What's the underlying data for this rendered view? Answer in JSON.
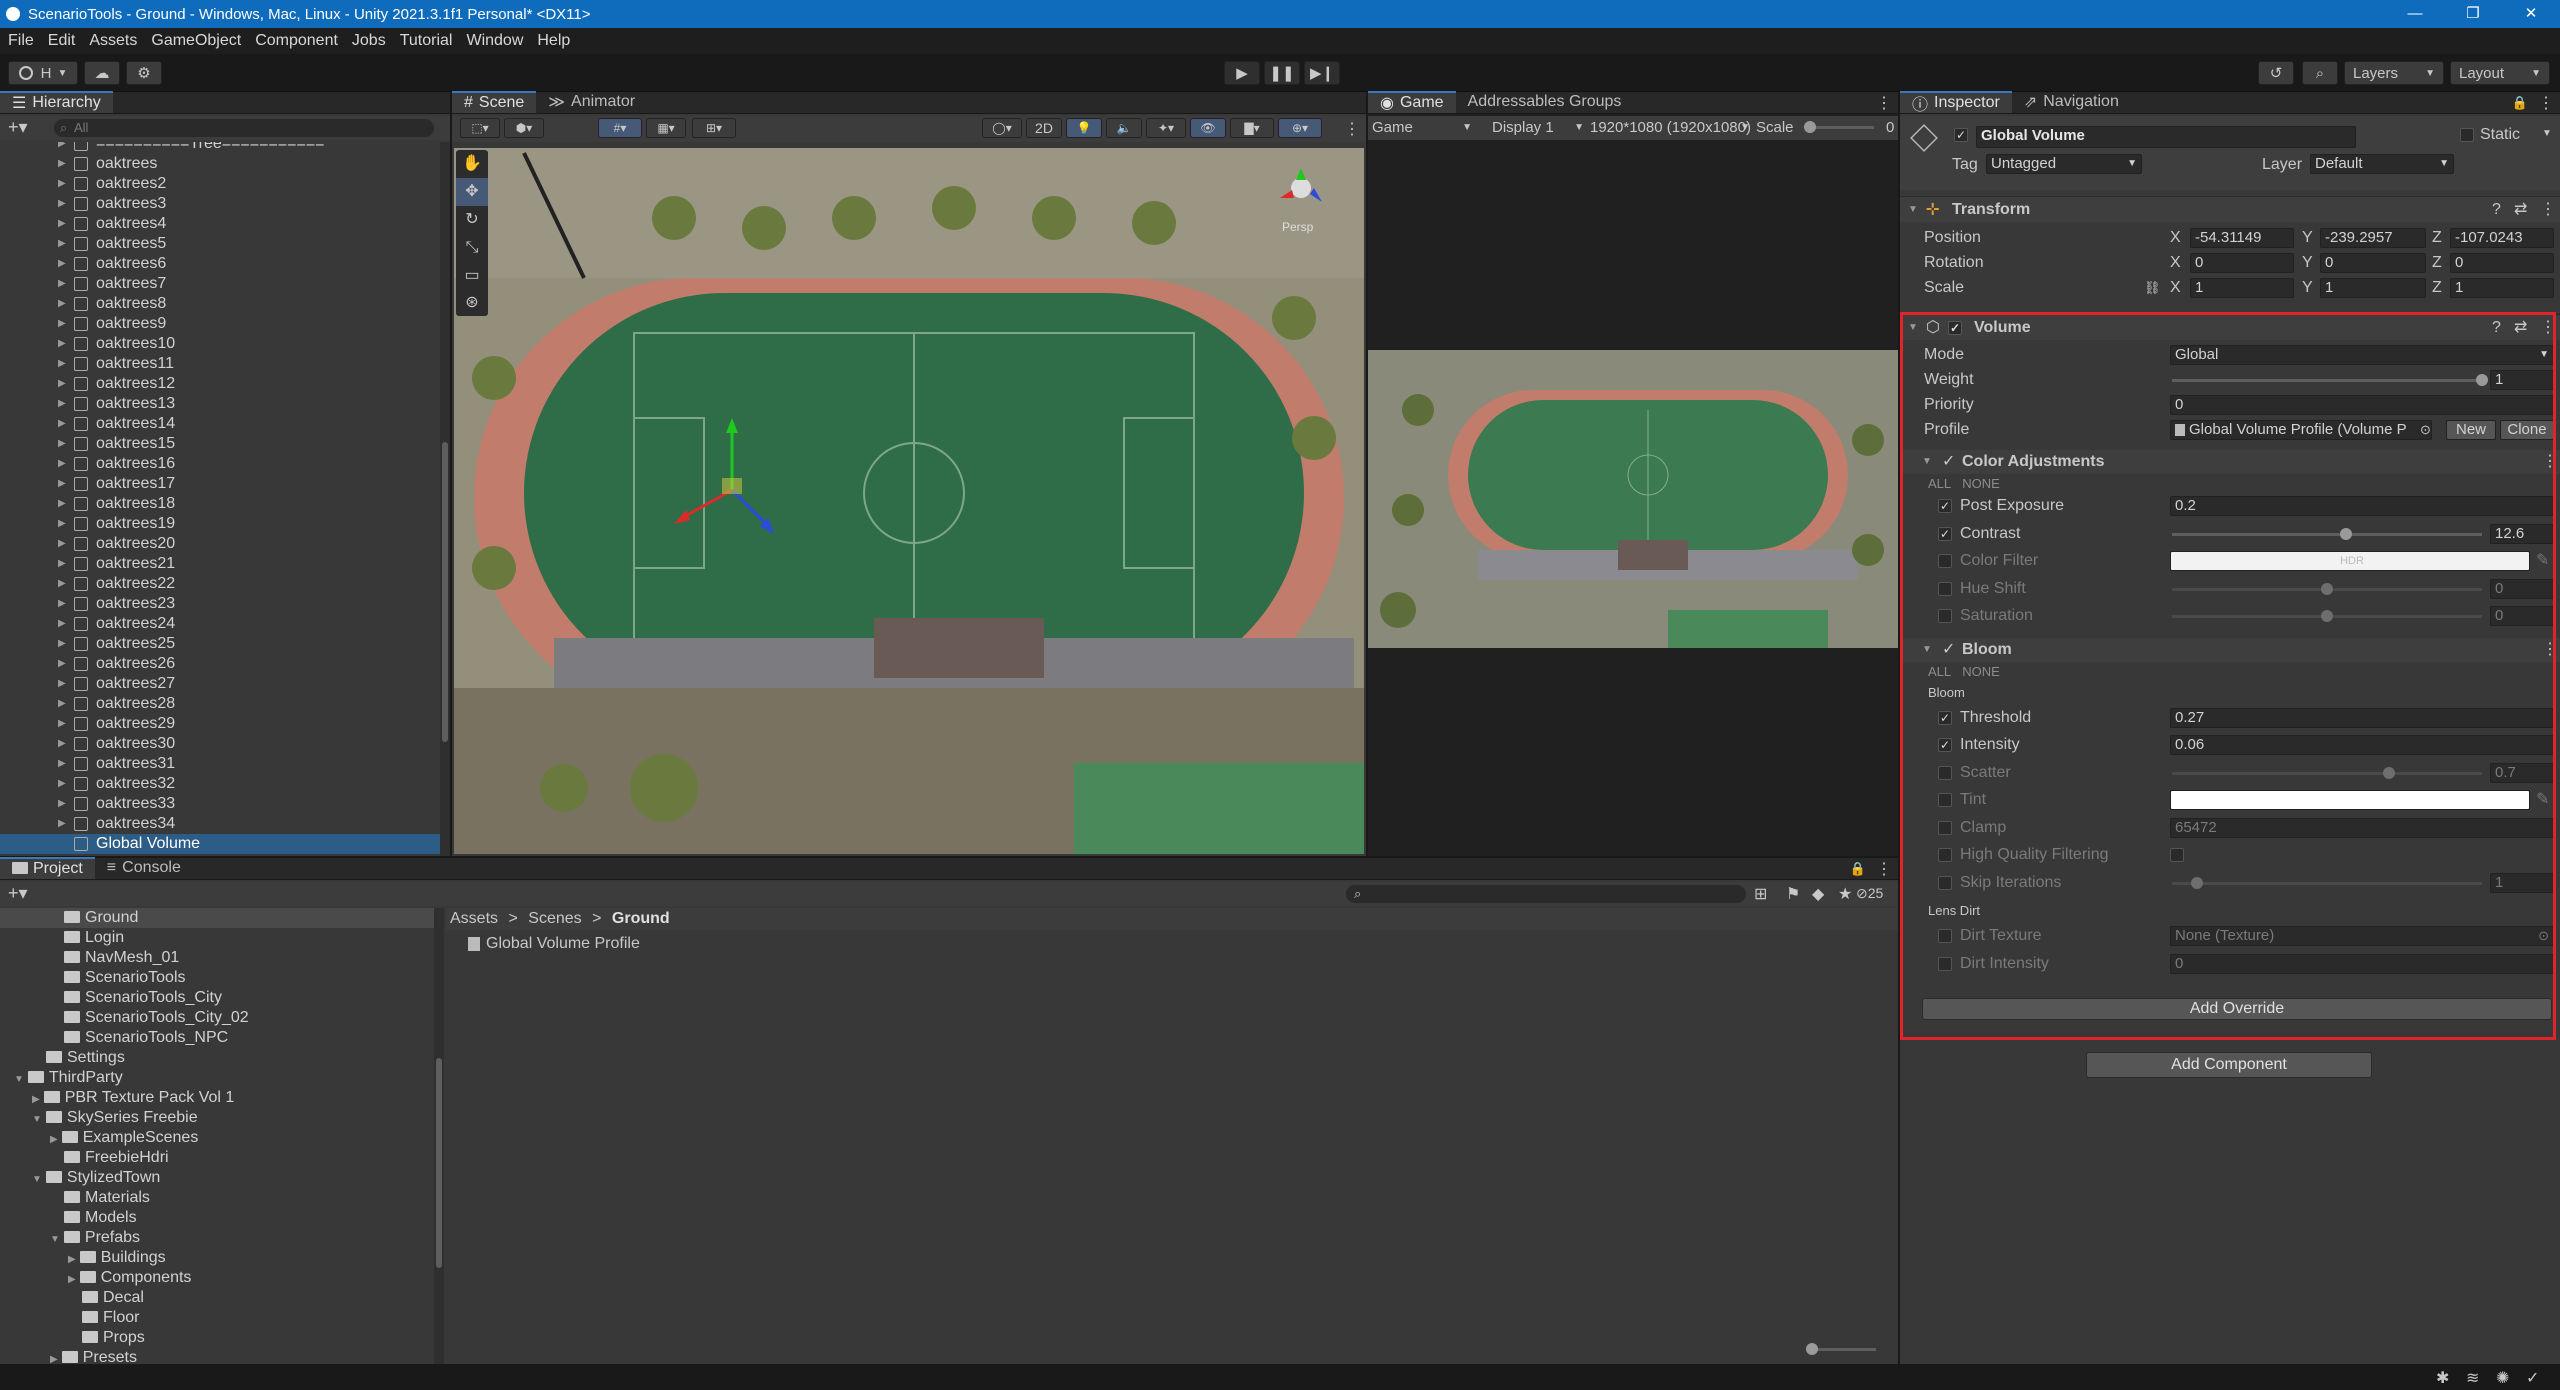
{
  "window": {
    "title": "ScenarioTools - Ground - Windows, Mac, Linux - Unity 2021.3.1f1 Personal* <DX11>",
    "controls": [
      "—",
      "❐",
      "✕"
    ]
  },
  "menu": [
    "File",
    "Edit",
    "Assets",
    "GameObject",
    "Component",
    "Jobs",
    "Tutorial",
    "Window",
    "Help"
  ],
  "toolbar": {
    "account_label": "H",
    "layers_label": "Layers",
    "layout_label": "Layout"
  },
  "hierarchy": {
    "tab_label": "Hierarchy",
    "search_placeholder": "All",
    "rows": [
      "==========Tree===========",
      "oaktrees",
      "oaktrees2",
      "oaktrees3",
      "oaktrees4",
      "oaktrees5",
      "oaktrees6",
      "oaktrees7",
      "oaktrees8",
      "oaktrees9",
      "oaktrees10",
      "oaktrees11",
      "oaktrees12",
      "oaktrees13",
      "oaktrees14",
      "oaktrees15",
      "oaktrees16",
      "oaktrees17",
      "oaktrees18",
      "oaktrees19",
      "oaktrees20",
      "oaktrees21",
      "oaktrees22",
      "oaktrees23",
      "oaktrees24",
      "oaktrees25",
      "oaktrees26",
      "oaktrees27",
      "oaktrees28",
      "oaktrees29",
      "oaktrees30",
      "oaktrees31",
      "oaktrees32",
      "oaktrees33",
      "oaktrees34"
    ],
    "selected": "Global Volume"
  },
  "scene": {
    "tabs": [
      "Scene",
      "Animator"
    ],
    "mode_2d": "2D",
    "gizmo_label": "Persp"
  },
  "game": {
    "tabs": [
      "Game",
      "Addressables Groups"
    ],
    "display_mode": "Game",
    "display": "Display 1",
    "resolution": "1920*1080 (1920x1080)",
    "scale_label": "Scale",
    "scale_value": "0"
  },
  "project": {
    "tabs": [
      "Project",
      "Console"
    ],
    "tree": [
      {
        "label": "Ground",
        "indent": 3
      },
      {
        "label": "Login",
        "indent": 3
      },
      {
        "label": "NavMesh_01",
        "indent": 3
      },
      {
        "label": "ScenarioTools",
        "indent": 3
      },
      {
        "label": "ScenarioTools_City",
        "indent": 3
      },
      {
        "label": "ScenarioTools_City_02",
        "indent": 3
      },
      {
        "label": "ScenarioTools_NPC",
        "indent": 3
      },
      {
        "label": "Settings",
        "indent": 2
      },
      {
        "label": "ThirdParty",
        "indent": 1,
        "open": true
      },
      {
        "label": "PBR Texture Pack Vol 1",
        "indent": 2,
        "closed": true
      },
      {
        "label": "SkySeries Freebie",
        "indent": 2,
        "open": true
      },
      {
        "label": "ExampleScenes",
        "indent": 3,
        "closed": true
      },
      {
        "label": "FreebieHdri",
        "indent": 3
      },
      {
        "label": "StylizedTown",
        "indent": 2,
        "open": true
      },
      {
        "label": "Materials",
        "indent": 3
      },
      {
        "label": "Models",
        "indent": 3
      },
      {
        "label": "Prefabs",
        "indent": 3,
        "open": true
      },
      {
        "label": "Buildings",
        "indent": 4,
        "closed": true
      },
      {
        "label": "Components",
        "indent": 4,
        "closed": true
      },
      {
        "label": "Decal",
        "indent": 4
      },
      {
        "label": "Floor",
        "indent": 4
      },
      {
        "label": "Props",
        "indent": 4
      },
      {
        "label": "Presets",
        "indent": 3,
        "closed": true
      }
    ],
    "breadcrumb": [
      "Assets",
      "Scenes",
      "Ground"
    ],
    "asset": "Global Volume Profile",
    "hidden_count": "25"
  },
  "inspector": {
    "tabs": [
      "Inspector",
      "Navigation"
    ],
    "object_name": "Global Volume",
    "static_label": "Static",
    "tag_label": "Tag",
    "tag_value": "Untagged",
    "layer_label": "Layer",
    "layer_value": "Default",
    "transform": {
      "title": "Transform",
      "position_label": "Position",
      "px": "-54.31149",
      "py": "-239.2957",
      "pz": "-107.0243",
      "rotation_label": "Rotation",
      "rx": "0",
      "ry": "0",
      "rz": "0",
      "scale_label": "Scale",
      "sx": "1",
      "sy": "1",
      "sz": "1"
    },
    "volume": {
      "title": "Volume",
      "mode_label": "Mode",
      "mode_value": "Global",
      "weight_label": "Weight",
      "weight_value": "1",
      "weight_frac": 1.0,
      "priority_label": "Priority",
      "priority_value": "0",
      "profile_label": "Profile",
      "profile_value": "Global Volume Profile (Volume P",
      "new_label": "New",
      "clone_label": "Clone"
    },
    "color_adjustments": {
      "title": "Color Adjustments",
      "all": "ALL",
      "none": "NONE",
      "post_exposure_label": "Post Exposure",
      "post_exposure_value": "0.2",
      "contrast_label": "Contrast",
      "contrast_value": "12.6",
      "contrast_frac": 0.56,
      "color_filter_label": "Color Filter",
      "hdr_label": "HDR",
      "hue_shift_label": "Hue Shift",
      "hue_shift_value": "0",
      "hue_frac": 0.5,
      "saturation_label": "Saturation",
      "saturation_value": "0",
      "sat_frac": 0.5
    },
    "bloom": {
      "title": "Bloom",
      "all": "ALL",
      "none": "NONE",
      "group_label": "Bloom",
      "threshold_label": "Threshold",
      "threshold_value": "0.27",
      "intensity_label": "Intensity",
      "intensity_value": "0.06",
      "scatter_label": "Scatter",
      "scatter_value": "0.7",
      "scatter_frac": 0.7,
      "tint_label": "Tint",
      "clamp_label": "Clamp",
      "clamp_value": "65472",
      "hq_label": "High Quality Filtering",
      "skip_label": "Skip Iterations",
      "skip_value": "1",
      "skip_frac": 0.08,
      "lens_dirt_label": "Lens Dirt",
      "dirt_texture_label": "Dirt Texture",
      "dirt_texture_value": "None (Texture)",
      "dirt_intensity_label": "Dirt Intensity",
      "dirt_intensity_value": "0"
    },
    "add_override_label": "Add Override",
    "add_component_label": "Add Component"
  },
  "colors": {
    "highlight_border": "#e0242a",
    "selection": "#2c5d87",
    "title_bar": "#0f6cbd"
  }
}
